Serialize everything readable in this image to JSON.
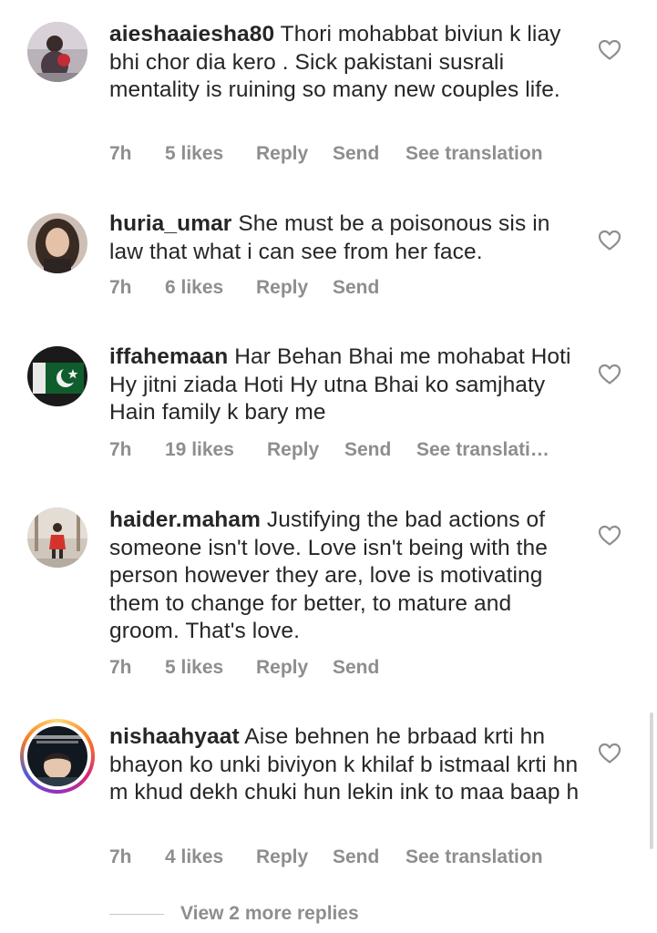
{
  "comments": [
    {
      "username": "aieshaaiesha80",
      "text": "Thori mohabbat biviun k liay bhi chor dia kero . Sick pakistani  susrali mentality is ruining so many new couples life.",
      "time": "7h",
      "likes": "5 likes",
      "reply": "Reply",
      "send": "Send",
      "translation": "See translation"
    },
    {
      "username": "huria_umar",
      "text": "She must be a poisonous sis in law that what i can see from her face.",
      "time": "7h",
      "likes": "6 likes",
      "reply": "Reply",
      "send": "Send"
    },
    {
      "username": "iffahemaan",
      "text": "Har Behan Bhai me mohabat Hoti Hy jitni ziada Hoti Hy utna Bhai ko samjhaty Hain family k bary me",
      "time": "7h",
      "likes": "19 likes",
      "reply": "Reply",
      "send": "Send",
      "translation": "See translati…"
    },
    {
      "username": "haider.maham",
      "text": "Justifying the bad actions of someone isn't love. Love isn't being with the person however they are, love is motivating them to change for better, to mature and groom. That's love.",
      "time": "7h",
      "likes": "5 likes",
      "reply": "Reply",
      "send": "Send"
    },
    {
      "username": "nishaahyaat",
      "text": "Aise behnen he brbaad krti hn bhayon ko unki biviyon k khilaf b istmaal krti hn m khud dekh chuki hun lekin ink to maa baap h",
      "time": "7h",
      "likes": "4 likes",
      "reply": "Reply",
      "send": "Send",
      "translation": "See translation"
    }
  ],
  "view_more_replies": "View 2 more replies",
  "icons": {
    "like": "heart-outline-icon"
  },
  "colors": {
    "text": "#262626",
    "meta": "#8e8e8e",
    "story_ring": [
      "#feda75",
      "#fa7e1e",
      "#d62976",
      "#962fbf",
      "#4f5bd5"
    ]
  }
}
